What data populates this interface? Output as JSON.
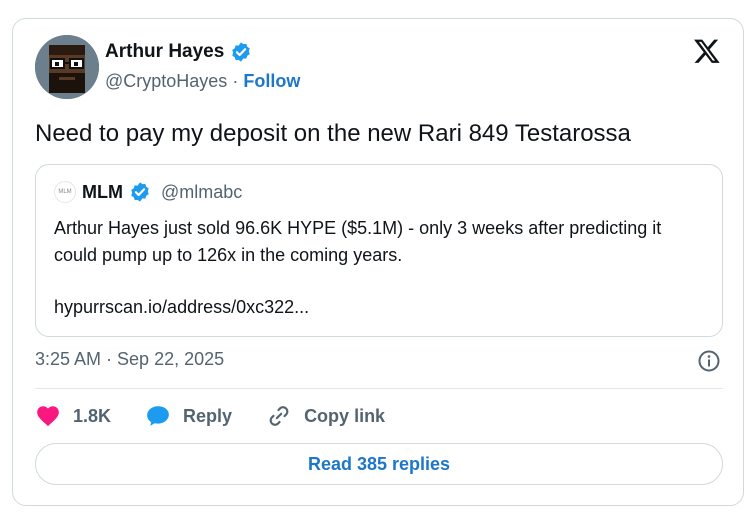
{
  "author": {
    "name": "Arthur Hayes",
    "handle": "@CryptoHayes",
    "separator": "·",
    "follow_label": "Follow",
    "avatar_icon": "pixel-avatar-bearded-man-with-glasses",
    "verified_icon": "verified-badge-icon"
  },
  "tweet": {
    "text": "Need to pay my deposit on the new Rari 849 Testarossa",
    "timestamp": "3:25 AM · Sep 22, 2025"
  },
  "quote": {
    "avatar_text": "MLM",
    "name": "MLM",
    "handle": "@mlmabc",
    "body": "Arthur Hayes just sold 96.6K HYPE ($5.1M) - only 3 weeks after predicting it could pump up to 126x in the coming years.",
    "link": "hypurrscan.io/address/0xc322..."
  },
  "actions": {
    "like_count": "1.8K",
    "reply_label": "Reply",
    "copy_label": "Copy link",
    "read_replies_label": "Read 385 replies"
  },
  "colors": {
    "accent": "#1d77c8",
    "verified": "#1d9bf0",
    "like": "#f91880",
    "border": "#cfd9de",
    "muted": "#536471"
  }
}
